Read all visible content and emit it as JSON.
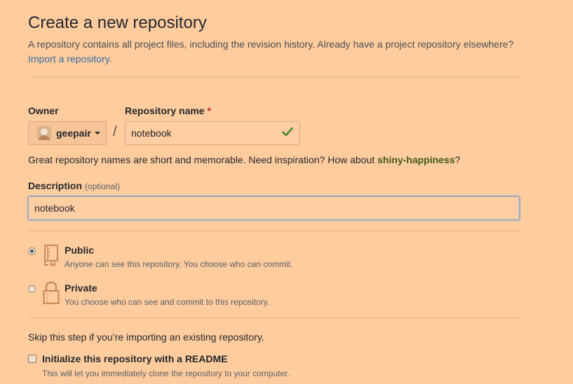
{
  "header": {
    "title": "Create a new repository",
    "intro_text": "A repository contains all project files, including the revision history. Already have a project repository elsewhere?",
    "import_link": "Import a repository."
  },
  "owner": {
    "label": "Owner",
    "value": "geepair"
  },
  "separator": "/",
  "repo_name": {
    "label": "Repository name",
    "required_mark": "*",
    "value": "notebook"
  },
  "hint": {
    "prefix": "Great repository names are short and memorable. Need inspiration? How about",
    "suggestion": "shiny-happiness",
    "suffix": "?"
  },
  "description": {
    "label": "Description",
    "optional": "(optional)",
    "value": "notebook"
  },
  "visibility": {
    "selected": "public",
    "public": {
      "label": "Public",
      "note": "Anyone can see this repository. You choose who can commit."
    },
    "private": {
      "label": "Private",
      "note": "You choose who can see and commit to this repository."
    }
  },
  "init": {
    "skip_text": "Skip this step if you’re importing an existing repository.",
    "readme_label": "Initialize this repository with a README",
    "readme_note": "This will let you immediately clone the repository to your computer.",
    "readme_checked": false
  },
  "icons": {
    "avatar": "user-avatar",
    "dropdown": "caret-down-icon",
    "valid": "check-icon",
    "public": "repo-book-icon",
    "private": "lock-icon"
  },
  "colors": {
    "background": "#ffcc9e",
    "link": "#3a6ea5",
    "success": "#4b8a2e",
    "required": "#cb2431",
    "icon": "#c98b56"
  }
}
